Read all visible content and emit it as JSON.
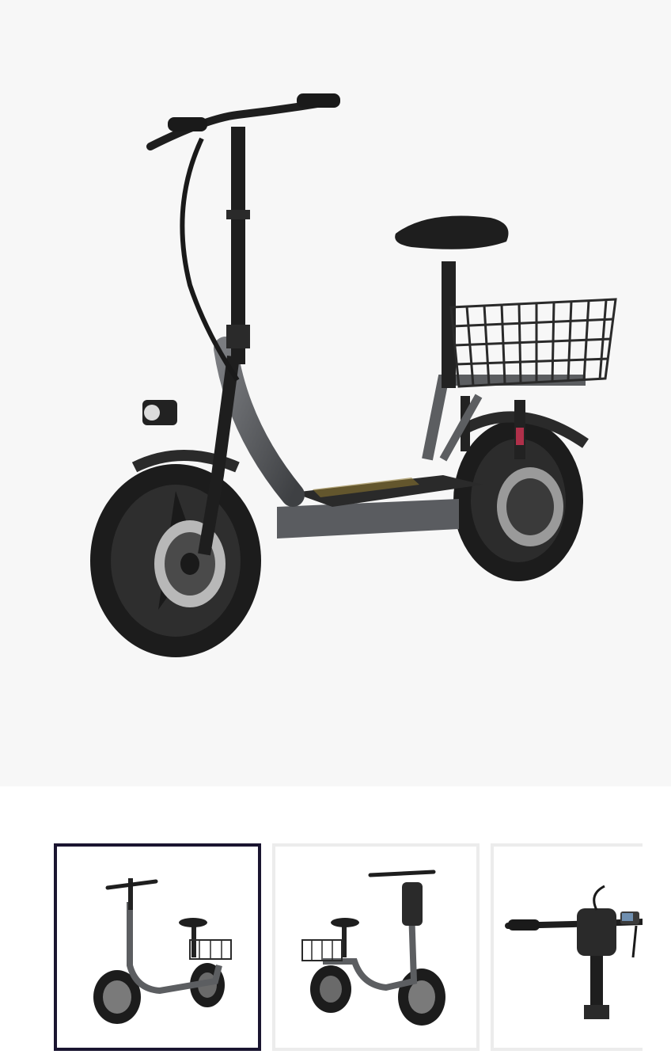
{
  "main_image": {
    "icon": "electric-scooter-with-seat-and-basket",
    "background": "#f7f7f7"
  },
  "thumbnails": [
    {
      "icon": "scooter-front-three-quarter-view",
      "selected": true
    },
    {
      "icon": "scooter-rear-three-quarter-view",
      "selected": false
    },
    {
      "icon": "scooter-handlebar-closeup",
      "selected": false
    }
  ],
  "colors": {
    "selected_border": "#1a1530",
    "thumb_border": "#ececec",
    "frame": "#5c5e61",
    "tire": "#1c1c1c"
  }
}
